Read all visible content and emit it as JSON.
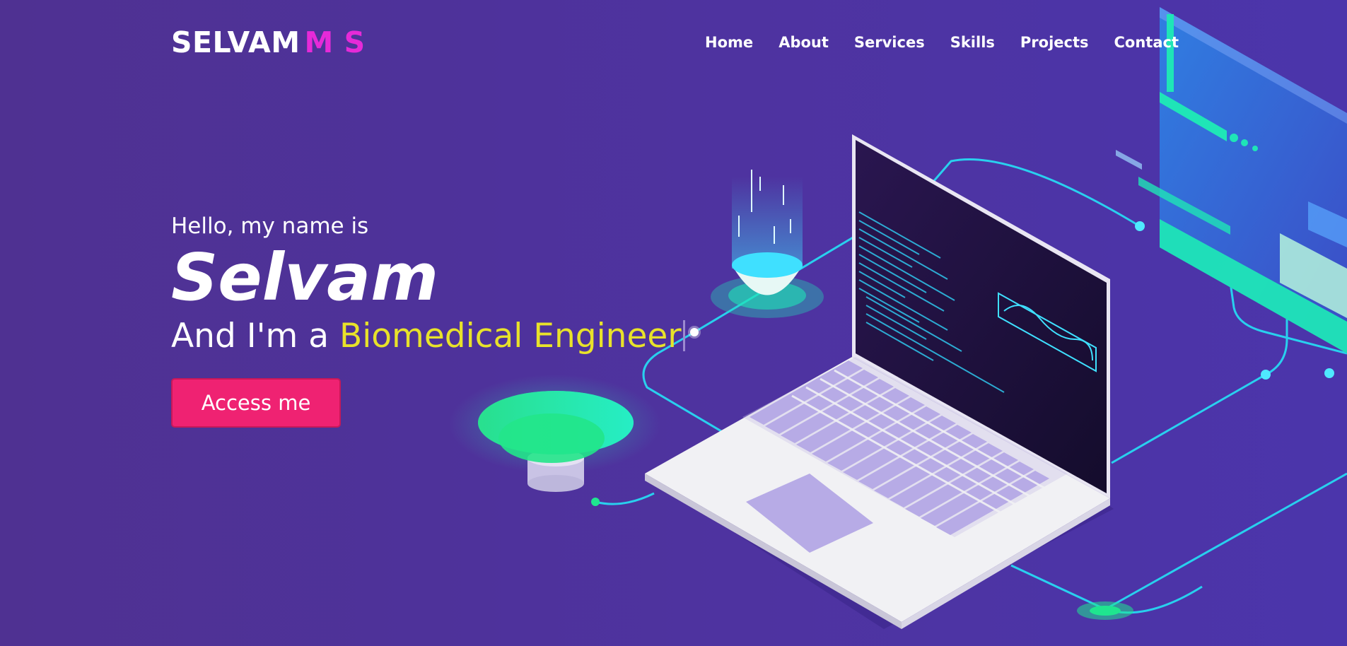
{
  "brand": {
    "first": "SELVAM",
    "accent": "M S"
  },
  "nav": {
    "items": [
      {
        "label": "Home"
      },
      {
        "label": "About"
      },
      {
        "label": "Services"
      },
      {
        "label": "Skills"
      },
      {
        "label": "Projects"
      },
      {
        "label": "Contact"
      }
    ]
  },
  "hero": {
    "greeting": "Hello, my name is",
    "name": "Selvam",
    "role_prefix": "And I'm a",
    "role": "Biomedical Engineer",
    "cta_label": "Access me"
  },
  "illustration": {
    "name": "isometric-laptop-illustration"
  },
  "colors": {
    "background": "#4e33a0",
    "brand_accent": "#e62ad8",
    "role_highlight": "#e8e22a",
    "cta_background": "#ef2272",
    "circuit_line": "#27d9f2",
    "glow_green": "#1fe58f"
  }
}
